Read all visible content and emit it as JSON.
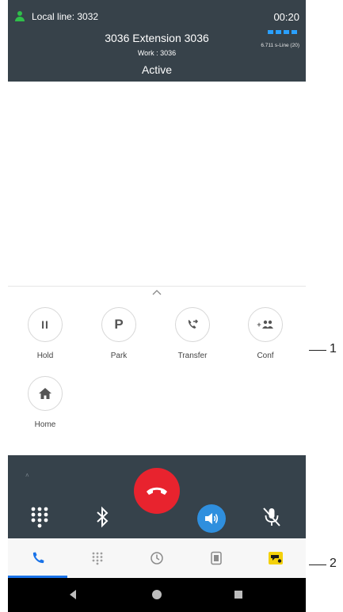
{
  "header": {
    "local_line": "Local line: 3032",
    "timer": "00:20",
    "line_label": "6.711 s-Line (20)",
    "extension_name": "3036 Extension 3036",
    "work": "Work : 3036",
    "status": "Active"
  },
  "actions": [
    {
      "label": "Hold",
      "icon": "pause-icon"
    },
    {
      "label": "Park",
      "icon": "park-icon",
      "glyph": "P"
    },
    {
      "label": "Transfer",
      "icon": "transfer-icon"
    },
    {
      "label": "Conf",
      "icon": "conference-icon",
      "glyph": "+"
    },
    {
      "label": "Home",
      "icon": "home-icon"
    }
  ],
  "callbar": {
    "mini_label": "˄",
    "controls": [
      "dialpad-icon",
      "bluetooth-icon",
      "hangup-icon",
      "speaker-icon",
      "mute-icon"
    ]
  },
  "tabs": [
    "phone-icon",
    "dialpad-icon",
    "history-icon",
    "contacts-icon",
    "voicemail-icon"
  ],
  "callouts": {
    "one": "1",
    "two": "2"
  },
  "colors": {
    "header_bg": "#37424a",
    "online": "#2fbf4a",
    "hangup": "#e8232e",
    "speaker_active": "#2f8fde",
    "accent": "#1a73e8",
    "voicemail": "#f4d10b"
  }
}
